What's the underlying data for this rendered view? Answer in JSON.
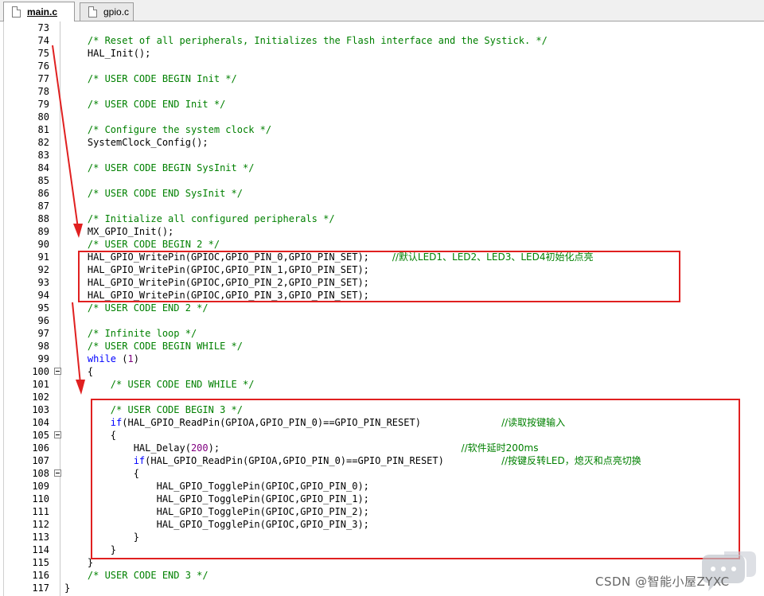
{
  "tabs": [
    {
      "label": "main.c",
      "active": true
    },
    {
      "label": "gpio.c",
      "active": false
    }
  ],
  "lines": [
    {
      "n": "73",
      "segs": []
    },
    {
      "n": "74",
      "segs": [
        {
          "t": "    /* Reset of all peripherals, Initializes the Flash interface and the Systick. */",
          "c": "c-com"
        }
      ]
    },
    {
      "n": "75",
      "segs": [
        {
          "t": "    HAL_Init();",
          "c": ""
        }
      ]
    },
    {
      "n": "76",
      "segs": []
    },
    {
      "n": "77",
      "segs": [
        {
          "t": "    /* USER CODE BEGIN Init */",
          "c": "c-com"
        }
      ]
    },
    {
      "n": "78",
      "segs": []
    },
    {
      "n": "79",
      "segs": [
        {
          "t": "    /* USER CODE END Init */",
          "c": "c-com"
        }
      ]
    },
    {
      "n": "80",
      "segs": []
    },
    {
      "n": "81",
      "segs": [
        {
          "t": "    /* Configure the system clock */",
          "c": "c-com"
        }
      ]
    },
    {
      "n": "82",
      "segs": [
        {
          "t": "    SystemClock_Config();",
          "c": ""
        }
      ]
    },
    {
      "n": "83",
      "segs": []
    },
    {
      "n": "84",
      "segs": [
        {
          "t": "    /* USER CODE BEGIN SysInit */",
          "c": "c-com"
        }
      ]
    },
    {
      "n": "85",
      "segs": []
    },
    {
      "n": "86",
      "segs": [
        {
          "t": "    /* USER CODE END SysInit */",
          "c": "c-com"
        }
      ]
    },
    {
      "n": "87",
      "segs": []
    },
    {
      "n": "88",
      "segs": [
        {
          "t": "    /* Initialize all configured peripherals */",
          "c": "c-com"
        }
      ]
    },
    {
      "n": "89",
      "segs": [
        {
          "t": "    MX_GPIO_Init();",
          "c": ""
        }
      ]
    },
    {
      "n": "90",
      "segs": [
        {
          "t": "    /* USER CODE BEGIN 2 */",
          "c": "c-com"
        }
      ]
    },
    {
      "n": "91",
      "segs": [
        {
          "t": "    HAL_GPIO_WritePin(GPIOC,GPIO_PIN_0,GPIO_PIN_SET);    ",
          "c": ""
        },
        {
          "t": "//默认LED1、LED2、LED3、LED4初始化点亮",
          "c": "c-cn"
        }
      ]
    },
    {
      "n": "92",
      "segs": [
        {
          "t": "    HAL_GPIO_WritePin(GPIOC,GPIO_PIN_1,GPIO_PIN_SET);",
          "c": ""
        }
      ]
    },
    {
      "n": "93",
      "segs": [
        {
          "t": "    HAL_GPIO_WritePin(GPIOC,GPIO_PIN_2,GPIO_PIN_SET);",
          "c": ""
        }
      ]
    },
    {
      "n": "94",
      "segs": [
        {
          "t": "    HAL_GPIO_WritePin(GPIOC,GPIO_PIN_3,GPIO_PIN_SET);",
          "c": ""
        }
      ]
    },
    {
      "n": "95",
      "segs": [
        {
          "t": "    /* USER CODE END 2 */",
          "c": "c-com"
        }
      ]
    },
    {
      "n": "96",
      "segs": []
    },
    {
      "n": "97",
      "segs": [
        {
          "t": "    /* Infinite loop */",
          "c": "c-com"
        }
      ]
    },
    {
      "n": "98",
      "segs": [
        {
          "t": "    /* USER CODE BEGIN WHILE */",
          "c": "c-com"
        }
      ]
    },
    {
      "n": "99",
      "segs": [
        {
          "t": "    ",
          "c": ""
        },
        {
          "t": "while",
          "c": "c-kw"
        },
        {
          "t": " (",
          "c": ""
        },
        {
          "t": "1",
          "c": "c-num"
        },
        {
          "t": ")",
          "c": ""
        }
      ]
    },
    {
      "n": "100",
      "fold": true,
      "segs": [
        {
          "t": "    {",
          "c": ""
        }
      ]
    },
    {
      "n": "101",
      "segs": [
        {
          "t": "        /* USER CODE END WHILE */",
          "c": "c-com"
        }
      ]
    },
    {
      "n": "102",
      "segs": []
    },
    {
      "n": "103",
      "segs": [
        {
          "t": "        /* USER CODE BEGIN 3 */",
          "c": "c-com"
        }
      ]
    },
    {
      "n": "104",
      "segs": [
        {
          "t": "        ",
          "c": ""
        },
        {
          "t": "if",
          "c": "c-kw"
        },
        {
          "t": "(HAL_GPIO_ReadPin(GPIOA,GPIO_PIN_0)==GPIO_PIN_RESET)              ",
          "c": ""
        },
        {
          "t": "//读取按键输入",
          "c": "c-cn"
        }
      ]
    },
    {
      "n": "105",
      "fold": true,
      "segs": [
        {
          "t": "        {",
          "c": ""
        }
      ]
    },
    {
      "n": "106",
      "segs": [
        {
          "t": "            HAL_Delay(",
          "c": ""
        },
        {
          "t": "200",
          "c": "c-num"
        },
        {
          "t": ");                                          ",
          "c": ""
        },
        {
          "t": "//软件延时200ms",
          "c": "c-cn"
        }
      ]
    },
    {
      "n": "107",
      "segs": [
        {
          "t": "            ",
          "c": ""
        },
        {
          "t": "if",
          "c": "c-kw"
        },
        {
          "t": "(HAL_GPIO_ReadPin(GPIOA,GPIO_PIN_0)==GPIO_PIN_RESET)          ",
          "c": ""
        },
        {
          "t": "//按键反转LED，熄灭和点亮切换",
          "c": "c-cn"
        }
      ]
    },
    {
      "n": "108",
      "fold": true,
      "segs": [
        {
          "t": "            {",
          "c": ""
        }
      ]
    },
    {
      "n": "109",
      "segs": [
        {
          "t": "                HAL_GPIO_TogglePin(GPIOC,GPIO_PIN_0);",
          "c": ""
        }
      ]
    },
    {
      "n": "110",
      "segs": [
        {
          "t": "                HAL_GPIO_TogglePin(GPIOC,GPIO_PIN_1);",
          "c": ""
        }
      ]
    },
    {
      "n": "111",
      "segs": [
        {
          "t": "                HAL_GPIO_TogglePin(GPIOC,GPIO_PIN_2);",
          "c": ""
        }
      ]
    },
    {
      "n": "112",
      "segs": [
        {
          "t": "                HAL_GPIO_TogglePin(GPIOC,GPIO_PIN_3);",
          "c": ""
        }
      ]
    },
    {
      "n": "113",
      "segs": [
        {
          "t": "            }",
          "c": ""
        }
      ]
    },
    {
      "n": "114",
      "segs": [
        {
          "t": "        }",
          "c": ""
        }
      ]
    },
    {
      "n": "115",
      "segs": [
        {
          "t": "    }",
          "c": ""
        }
      ]
    },
    {
      "n": "116",
      "segs": [
        {
          "t": "    /* USER CODE END 3 */",
          "c": "c-com"
        }
      ]
    },
    {
      "n": "117",
      "segs": [
        {
          "t": "}",
          "c": ""
        }
      ]
    }
  ],
  "watermark": {
    "text": "CSDN @智能小屋ZYXC"
  },
  "colors": {
    "comment": "#008000",
    "keyword": "#0000ff",
    "number": "#800080",
    "highlight": "#e02020"
  }
}
